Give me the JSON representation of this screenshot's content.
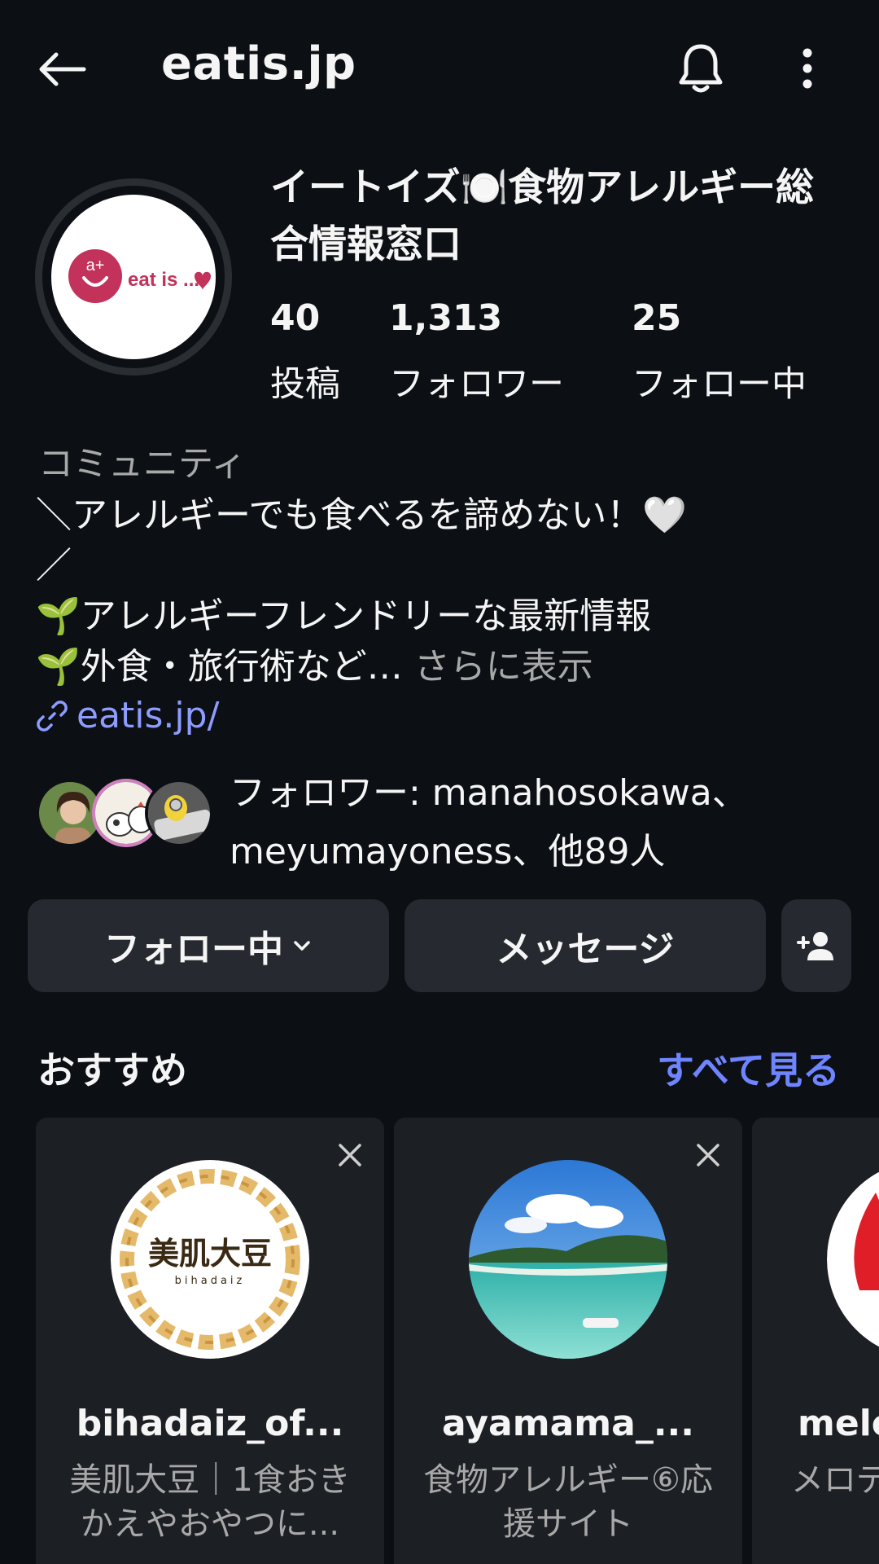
{
  "header": {
    "username": "eatis.jp"
  },
  "profile": {
    "display_name": "イートイズ🍽️食物アレルギー総合情報窓口",
    "avatar_logo_text": "eat is ...",
    "stats": [
      {
        "num": "40",
        "label": "投稿"
      },
      {
        "num": "1,313",
        "label": "フォロワー"
      },
      {
        "num": "25",
        "label": "フォロー中"
      }
    ],
    "category": "コミュニティ",
    "bio_line1": "＼アレルギーでも食べるを諦めない！🤍",
    "bio_line2": "／",
    "bio_line3": "🌱アレルギーフレンドリーな最新情報",
    "bio_line4": "🌱外食・旅行術など…",
    "bio_more": " さらに表示",
    "link": "eatis.jp/",
    "followed_by": "フォロワー: manahosokawa、meyumayoness、他89人"
  },
  "actions": {
    "following": "フォロー中",
    "message": "メッセージ"
  },
  "suggestions": {
    "title": "おすすめ",
    "see_all": "すべて見る",
    "cards": [
      {
        "username": "bihadaiz_of...",
        "logo_main": "美肌大豆",
        "logo_sub": "bihadaiz",
        "desc": "美肌大豆｜1食おきかえやおやつに..."
      },
      {
        "username": "ayamama_...",
        "desc": "食物アレルギー⑥応援サイト"
      },
      {
        "username": "melo",
        "desc": "メロデ モニ"
      }
    ]
  },
  "colors": {
    "background": "#0c1014",
    "button": "#262a30",
    "link": "#8e9cff",
    "accent": "#6f84ff",
    "brand": "#c2325a"
  }
}
